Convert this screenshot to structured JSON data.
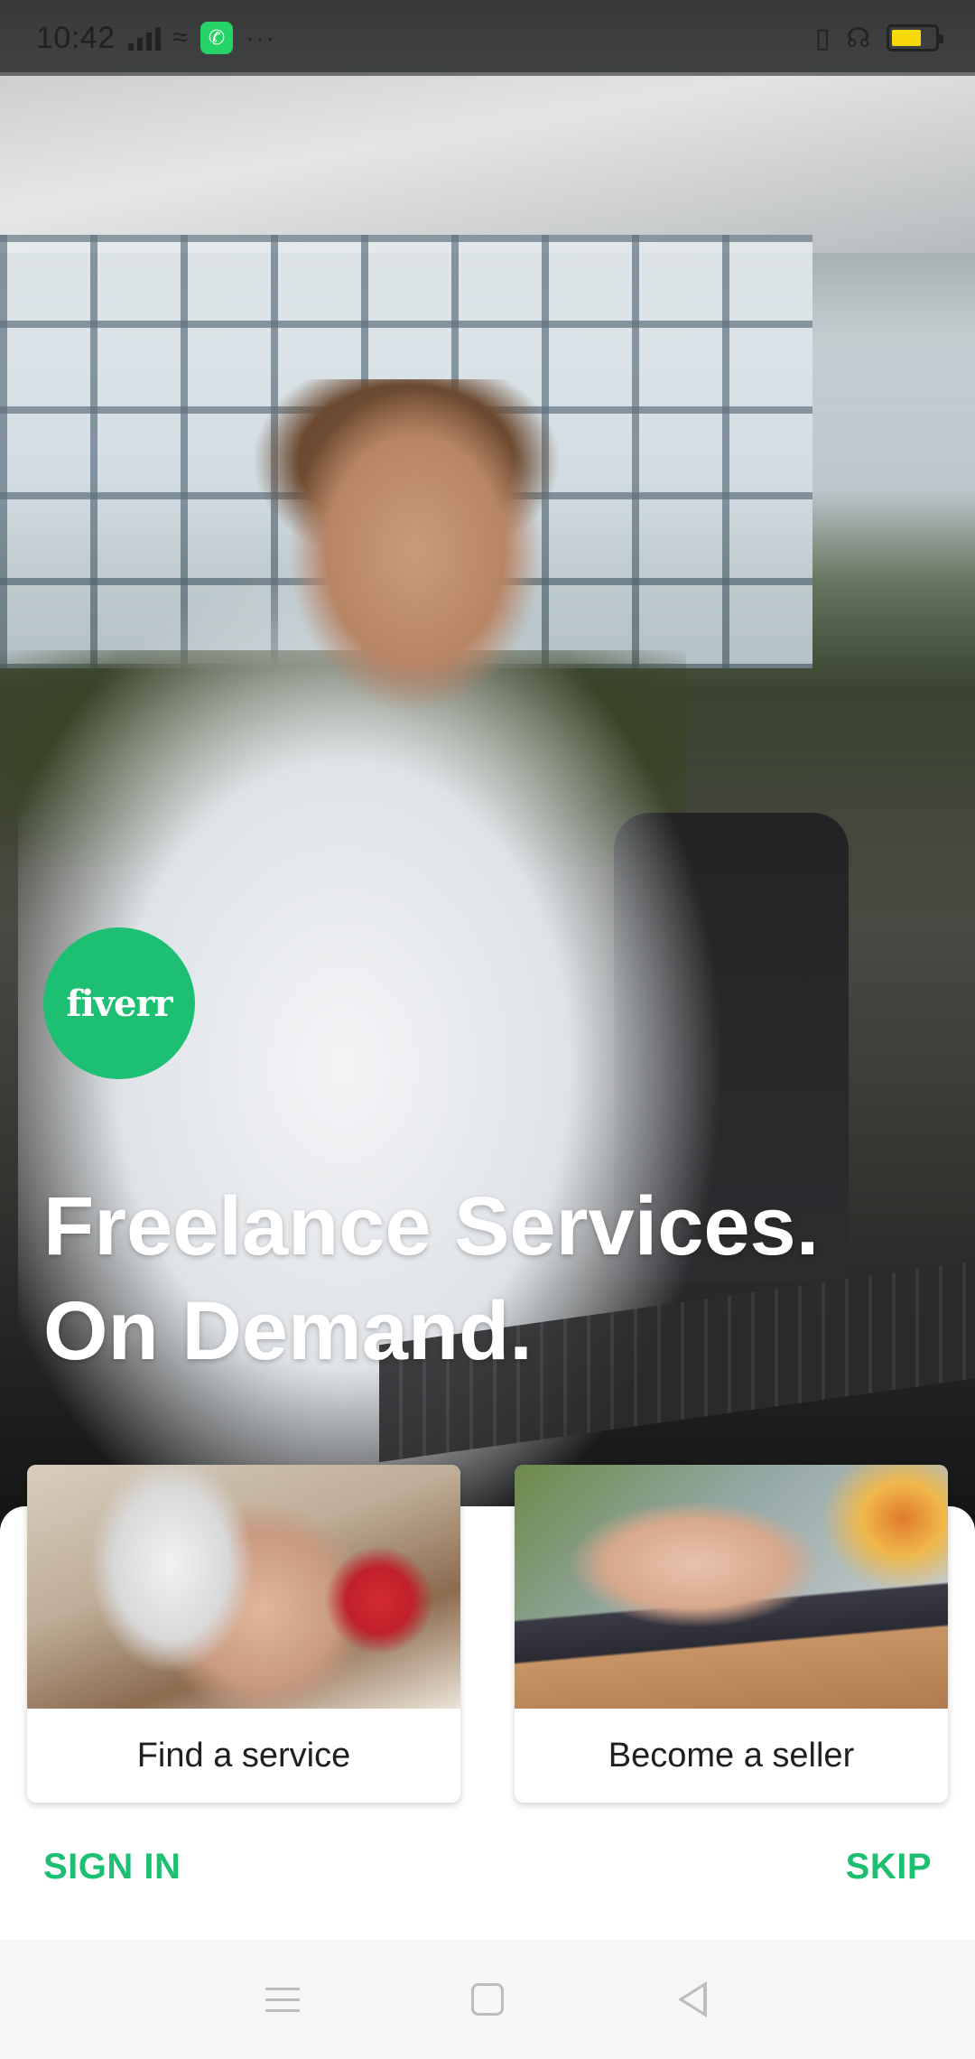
{
  "status_bar": {
    "time": "10:42",
    "more_indicator": "···",
    "icons": [
      "signal-icon",
      "wifi-icon",
      "whatsapp-icon",
      "vibrate-icon",
      "headset-icon",
      "battery-icon"
    ]
  },
  "brand": {
    "logo_text": "fiverr",
    "accent_color": "#1dbf73"
  },
  "hero": {
    "headline_line1": "Freelance Services.",
    "headline_line2": "On Demand."
  },
  "cards": [
    {
      "label": "Find a service"
    },
    {
      "label": "Become a seller"
    }
  ],
  "actions": {
    "sign_in": "SIGN IN",
    "skip": "SKIP"
  },
  "nav_bar": {
    "icons": [
      "menu-icon",
      "home-icon",
      "back-icon"
    ]
  }
}
